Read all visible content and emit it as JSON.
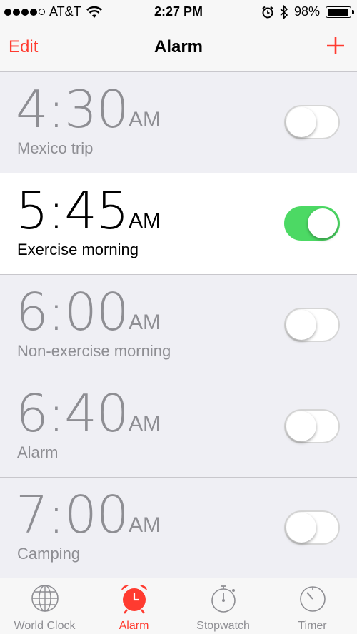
{
  "status_bar": {
    "carrier": "AT&T",
    "time": "2:27 PM",
    "battery": "98%",
    "signal_bars": 4,
    "battery_level": 0.98
  },
  "nav": {
    "edit_label": "Edit",
    "title": "Alarm",
    "add_icon": "plus-icon"
  },
  "alarms": [
    {
      "time": "4:30",
      "ampm": "AM",
      "label": "Mexico trip",
      "enabled": false
    },
    {
      "time": "5:45",
      "ampm": "AM",
      "label": "Exercise morning",
      "enabled": true
    },
    {
      "time": "6:00",
      "ampm": "AM",
      "label": "Non-exercise morning",
      "enabled": false
    },
    {
      "time": "6:40",
      "ampm": "AM",
      "label": "Alarm",
      "enabled": false
    },
    {
      "time": "7:00",
      "ampm": "AM",
      "label": "Camping",
      "enabled": false
    }
  ],
  "tabs": [
    {
      "label": "World Clock",
      "icon": "globe-icon",
      "active": false
    },
    {
      "label": "Alarm",
      "icon": "alarm-clock-icon",
      "active": true
    },
    {
      "label": "Stopwatch",
      "icon": "stopwatch-icon",
      "active": false
    },
    {
      "label": "Timer",
      "icon": "timer-icon",
      "active": false
    }
  ],
  "colors": {
    "accent": "#ff3b30",
    "toggle_on": "#4cd964",
    "inactive_text": "#8e8e93"
  }
}
